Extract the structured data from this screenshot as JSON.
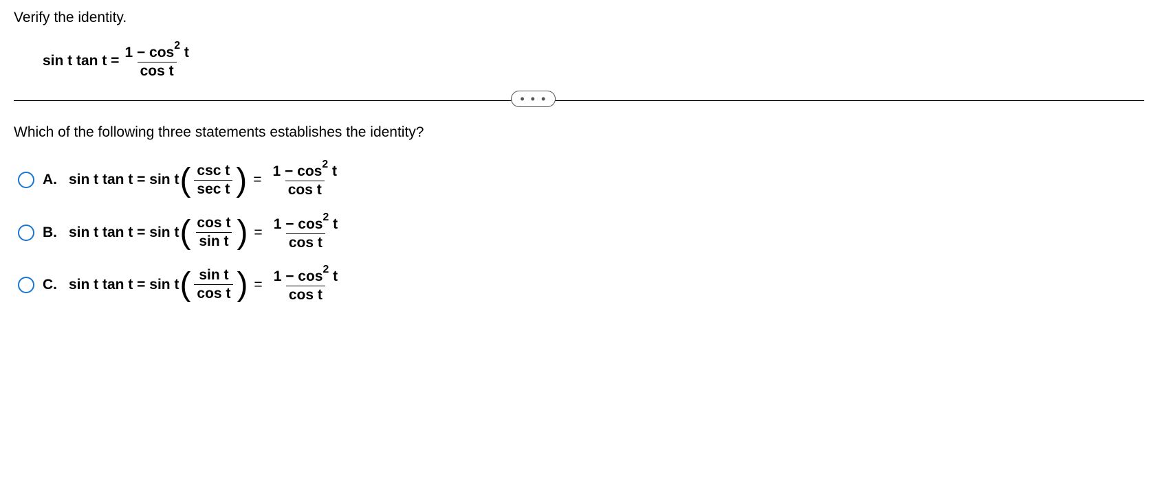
{
  "instruction": "Verify the identity.",
  "identity": {
    "lhs": "sin  t tan  t =",
    "rhs_num": "1 − cos",
    "rhs_sup": "2",
    "rhs_num_tail": " t",
    "rhs_den": "cos  t"
  },
  "divider_label": "• • •",
  "question": "Which of the following three statements establishes the identity?",
  "choices": [
    {
      "label": "A.",
      "lhs_pre": "sin  t tan  t = sin  t",
      "mid_num": "csc  t",
      "mid_den": "sec  t",
      "rhs_num": "1 − cos",
      "rhs_sup": "2",
      "rhs_num_tail": " t",
      "rhs_den": "cos  t"
    },
    {
      "label": "B.",
      "lhs_pre": "sin  t tan  t = sin  t",
      "mid_num": "cos  t",
      "mid_den": "sin  t",
      "rhs_num": "1 − cos",
      "rhs_sup": "2",
      "rhs_num_tail": " t",
      "rhs_den": "cos  t"
    },
    {
      "label": "C.",
      "lhs_pre": "sin  t tan  t = sin  t",
      "mid_num": "sin  t",
      "mid_den": "cos  t",
      "rhs_num": "1 − cos",
      "rhs_sup": "2",
      "rhs_num_tail": " t",
      "rhs_den": "cos  t"
    }
  ]
}
